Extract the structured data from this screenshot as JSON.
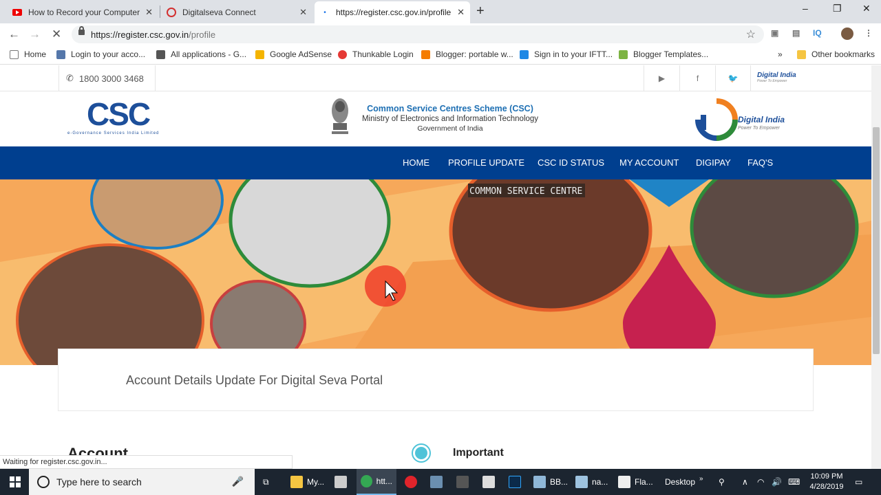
{
  "tabs": [
    {
      "title": "How to Record your Computer S",
      "icon": "youtube-icon"
    },
    {
      "title": "Digitalseva Connect",
      "icon": "digitalseva-icon"
    },
    {
      "title": "https://register.csc.gov.in/profile",
      "icon": "loading-icon"
    }
  ],
  "window_controls": {
    "minimize": "–",
    "maximize": "❐",
    "close": "✕"
  },
  "address": {
    "base": "https://register.csc.gov.in",
    "path": "/profile"
  },
  "bookmarks": [
    {
      "label": "Home",
      "color": "#ffffff"
    },
    {
      "label": "Login to your acco...",
      "color": "#5577aa"
    },
    {
      "label": "All applications - G...",
      "color": "#555555"
    },
    {
      "label": "Google AdSense",
      "color": "#f4b400"
    },
    {
      "label": "Thunkable Login",
      "color": "#e53935"
    },
    {
      "label": "Blogger: portable w...",
      "color": "#f57c00"
    },
    {
      "label": "Sign in to your IFTT...",
      "color": "#1e88e5"
    },
    {
      "label": "Blogger Templates...",
      "color": "#7cb342"
    }
  ],
  "bookmarks_more": "»",
  "other_bookmarks": "Other bookmarks",
  "site": {
    "phone": "1800 3000 3468",
    "social": [
      "youtube-icon",
      "facebook-icon",
      "twitter-icon"
    ],
    "top_logo_text": "Digital India",
    "top_logo_tag": "Power To Empower",
    "csc_letters": "CSC",
    "csc_sub": "e-Governance Services India Limited",
    "scheme_title": "Common Service Centres Scheme (CSC)",
    "scheme_ministry": "Ministry of Electronics and Information Technology",
    "scheme_gov": "Government of India",
    "di_text": "Digital India",
    "di_tag": "Power To Empower",
    "nav": [
      "HOME",
      "PROFILE UPDATE",
      "CSC ID STATUS",
      "MY ACCOUNT",
      "DIGIPAY",
      "FAQ'S"
    ],
    "banner_sign": "COMMON SERVICE CENTRE",
    "card_title": "Account Details Update For Digital Seva Portal",
    "account_heading": "Account",
    "important": "Important"
  },
  "status_text": "Waiting for register.csc.gov.in...",
  "taskbar": {
    "search_placeholder": "Type here to search",
    "apps": [
      "My...",
      "htt...",
      "BB...",
      "na...",
      "Fla..."
    ],
    "desktop": "Desktop",
    "time": "10:09 PM",
    "date": "4/28/2019"
  },
  "colors": {
    "nav_blue": "#003f8f",
    "banner_orange": "#f6a85a",
    "accent_teal": "#4fc3d8"
  }
}
